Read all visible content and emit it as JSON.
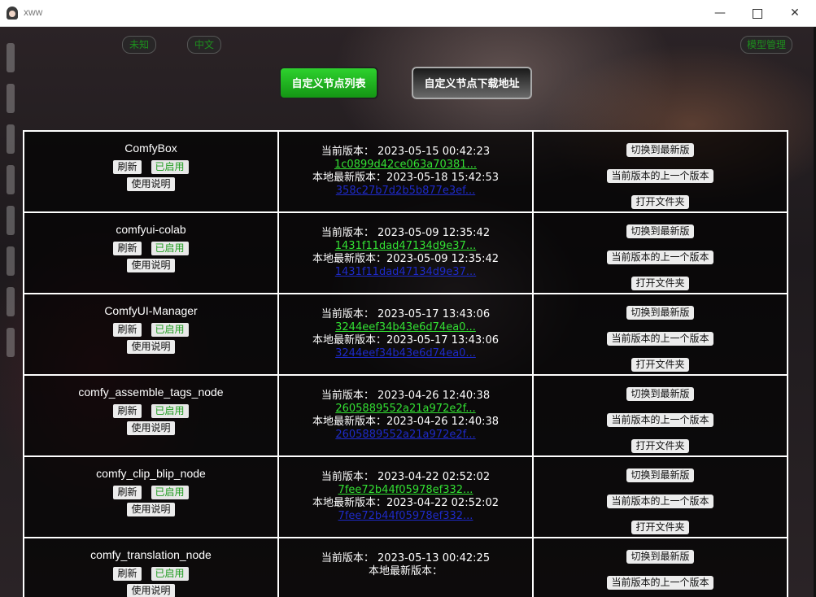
{
  "window": {
    "title": "xww",
    "minimize": "—",
    "close": "✕"
  },
  "top": {
    "pill_left": "未知",
    "pill_mid": "中文",
    "pill_right": "模型管理"
  },
  "nav": {
    "node_list": "自定义节点列表",
    "download_url": "自定义节点下载地址"
  },
  "labels": {
    "refresh": "刷新",
    "enabled": "已启用",
    "usage": "使用说明",
    "current_version": "当前版本：",
    "local_latest": "本地最新版本：",
    "switch_latest": "切换到最新版",
    "prev_version": "当前版本的上一个版本",
    "open_folder": "打开文件夹"
  },
  "nodes": [
    {
      "name": "ComfyBox",
      "current_date": "2023-05-15 00:42:23",
      "current_hash": "1c0899d42ce063a70381...",
      "latest_date": "2023-05-18 15:42:53",
      "latest_hash": "358c27b7d2b5b877e3ef..."
    },
    {
      "name": "comfyui-colab",
      "current_date": "2023-05-09 12:35:42",
      "current_hash": "1431f11dad47134d9e37...",
      "latest_date": "2023-05-09 12:35:42",
      "latest_hash": "1431f11dad47134d9e37..."
    },
    {
      "name": "ComfyUI-Manager",
      "current_date": "2023-05-17 13:43:06",
      "current_hash": "3244eef34b43e6d74ea0...",
      "latest_date": "2023-05-17 13:43:06",
      "latest_hash": "3244eef34b43e6d74ea0..."
    },
    {
      "name": "comfy_assemble_tags_node",
      "current_date": "2023-04-26 12:40:38",
      "current_hash": "2605889552a21a972e2f...",
      "latest_date": "2023-04-26 12:40:38",
      "latest_hash": "2605889552a21a972e2f..."
    },
    {
      "name": "comfy_clip_blip_node",
      "current_date": "2023-04-22 02:52:02",
      "current_hash": "7fee72b44f05978ef332...",
      "latest_date": "2023-04-22 02:52:02",
      "latest_hash": "7fee72b44f05978ef332..."
    },
    {
      "name": "comfy_translation_node",
      "current_date": "2023-05-13 00:42:25",
      "current_hash": "",
      "latest_date": "",
      "latest_hash": ""
    }
  ]
}
